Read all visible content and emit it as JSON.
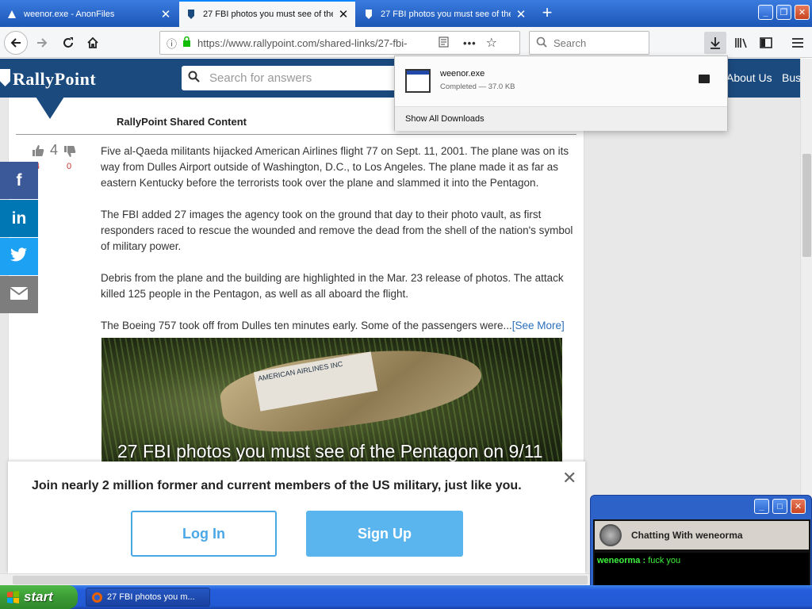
{
  "browser": {
    "tabs": [
      {
        "label": "weenor.exe - AnonFiles"
      },
      {
        "label": "27 FBI photos you must see of the"
      },
      {
        "label": "27 FBI photos you must see of the"
      }
    ],
    "url": "https://www.rallypoint.com/shared-links/27-fbi-",
    "search_placeholder": "Search"
  },
  "site": {
    "logo": "RallyPoint",
    "search_placeholder": "Search for answers",
    "nav": [
      "About Us",
      "Bus"
    ]
  },
  "article": {
    "section_heading": "RallyPoint Shared Content",
    "upvotes": "4",
    "upvote_count_small": "4",
    "downvotes": "0",
    "paragraphs": [
      "Five al-Qaeda militants hijacked American Airlines flight 77 on Sept. 11, 2001. The plane was on its way from Dulles Airport outside of Washington, D.C., to Los Angeles. The plane made it as far as eastern Kentucky before the terrorists took over the plane and slammed it into the Pentagon.",
      "The FBI added 27 images the agency took on the ground that day to their photo vault, as first responders raced to rescue the wounded and remove the dead from the shell of the nation's symbol of military power.",
      "Debris from the plane and the building are highlighted in the Mar. 23 release of photos. The attack killed 125 people in the Pentagon, as well as all aboard the flight.",
      "The Boeing 757 took off from Dulles ten minutes early. Some of the passengers were..."
    ],
    "see_more": "[See More]",
    "image_caption": "27 FBI photos you must see of the Pentagon on 9/11",
    "image_tag_text": "AMERICAN AIRLINES INC"
  },
  "social": [
    {
      "name": "facebook",
      "glyph": "f",
      "color": "#3b5998"
    },
    {
      "name": "linkedin",
      "glyph": "in",
      "color": "#0077b5"
    },
    {
      "name": "twitter",
      "glyph": "t",
      "color": "#1da1f2"
    },
    {
      "name": "email",
      "glyph": "✉",
      "color": "#7d7d7d"
    }
  ],
  "modal": {
    "message": "Join nearly 2 million former and current members of the US military, just like you.",
    "login_label": "Log In",
    "signup_label": "Sign Up"
  },
  "downloads": {
    "filename": "weenor.exe",
    "status": "Completed — 37.0 KB",
    "show_all": "Show All Downloads"
  },
  "chat": {
    "title": "Chatting With weneorma",
    "sender": "weneorma :",
    "message": "fuck you"
  },
  "taskbar": {
    "start_label": "start",
    "item_label": "27 FBI photos you m..."
  },
  "colors": {
    "site_header": "#1b4a7e",
    "accent": "#5ab4ee",
    "chat_text": "#3ef23e"
  }
}
